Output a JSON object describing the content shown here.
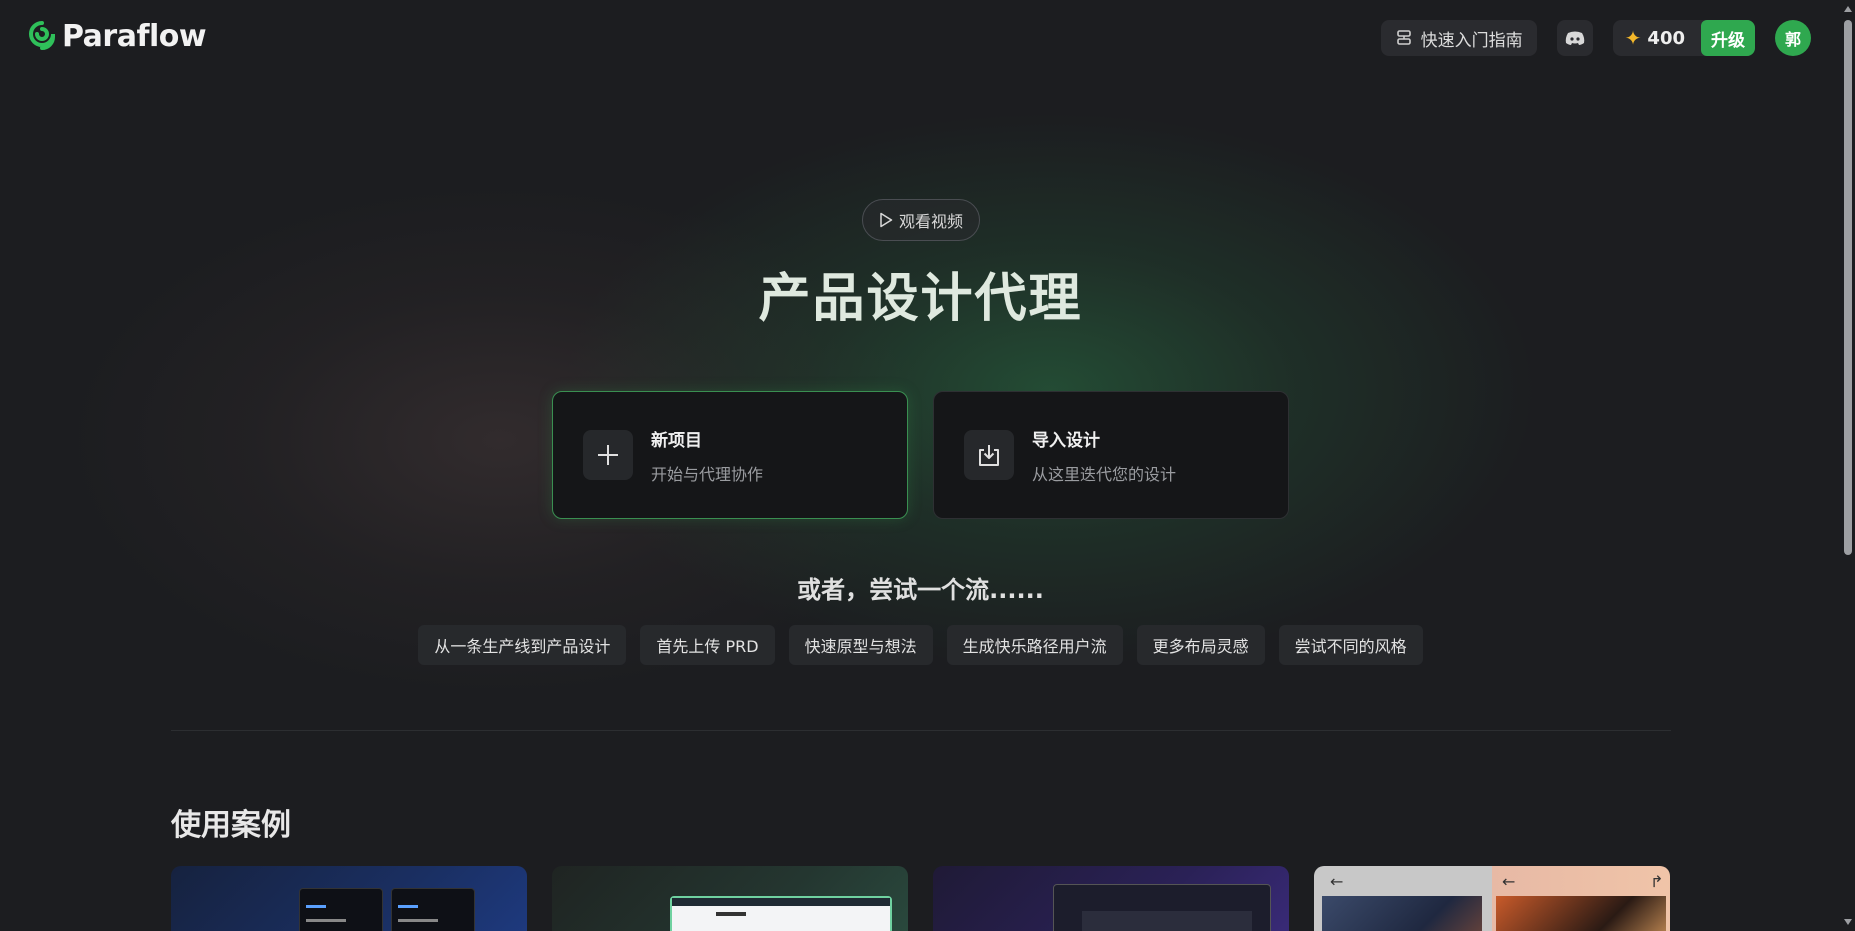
{
  "header": {
    "logo_text": "Paraflow",
    "guide_label": "快速入门指南",
    "discord_icon": "discord-icon",
    "credits_count": "400",
    "upgrade_label": "升级",
    "avatar_initial": "郭"
  },
  "hero": {
    "watch_video_label": "观看视频",
    "title": "产品设计代理",
    "cards": [
      {
        "title": "新项目",
        "subtitle": "开始与代理协作",
        "icon": "plus-icon"
      },
      {
        "title": "导入设计",
        "subtitle": "从这里迭代您的设计",
        "icon": "import-icon"
      }
    ],
    "or_title": "或者，尝试一个流......",
    "chips": [
      "从一条生产线到产品设计",
      "首先上传 PRD",
      "快速原型与想法",
      "生成快乐路径用户流",
      "更多布局灵感",
      "尝试不同的风格"
    ]
  },
  "cases": {
    "title": "使用案例"
  },
  "colors": {
    "accent": "#2fa84f",
    "background": "#1c1d20",
    "star": "#f4b82a"
  }
}
